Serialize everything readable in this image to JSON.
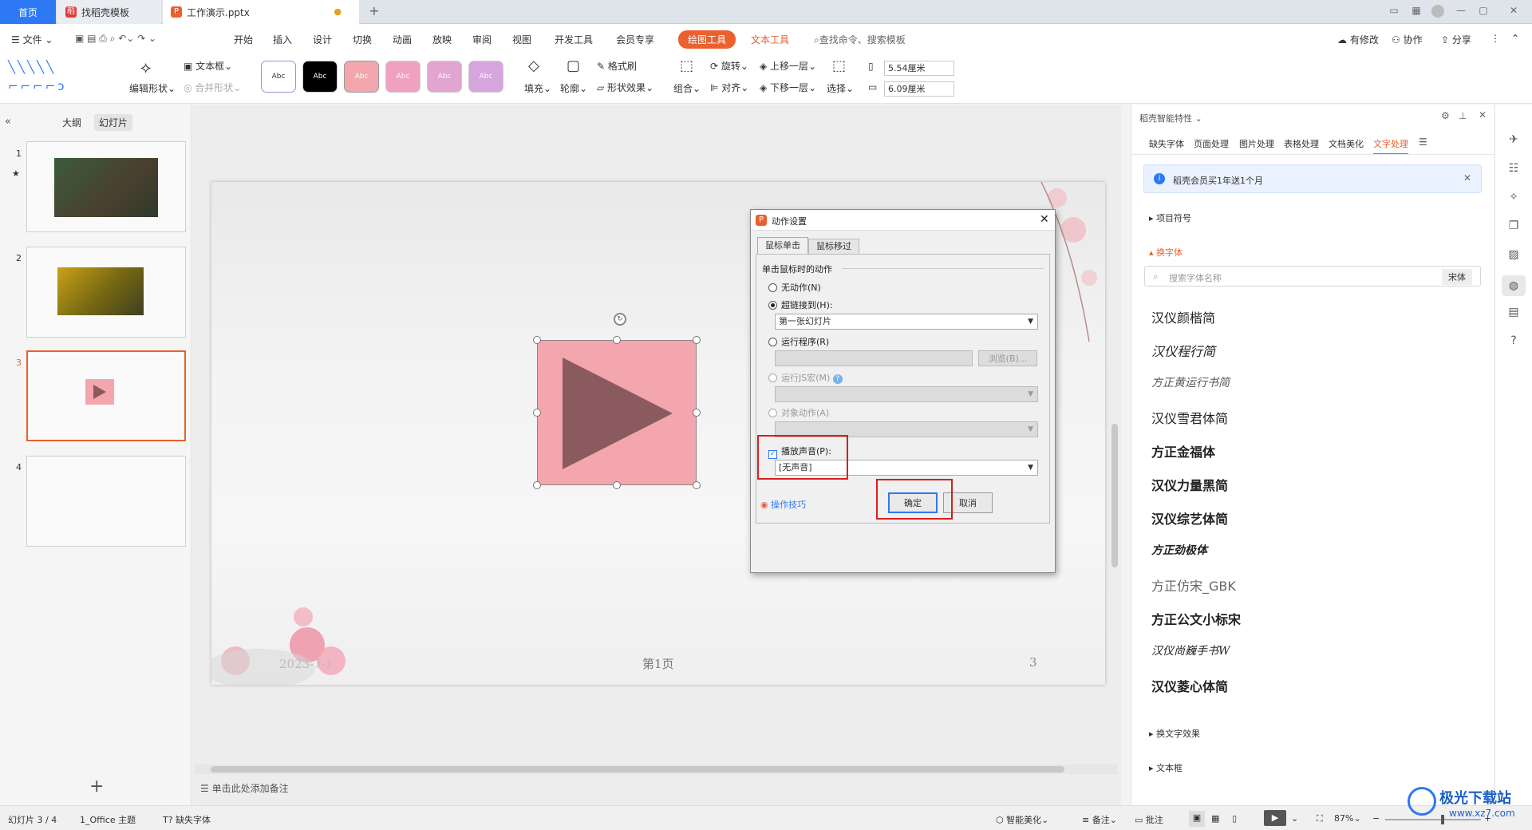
{
  "tabs": {
    "home": "首页",
    "template": "找稻壳模板",
    "file": "工作演示.pptx"
  },
  "menu": {
    "file": "文件",
    "items": [
      "开始",
      "插入",
      "设计",
      "切换",
      "动画",
      "放映",
      "审阅",
      "视图",
      "开发工具",
      "会员专享"
    ],
    "drawing_tools": "绘图工具",
    "text_tools": "文本工具",
    "search": "查找命令、搜索模板",
    "changes": "有修改",
    "collab": "协作",
    "share": "分享"
  },
  "toolbar": {
    "edit_shape": "编辑形状",
    "textbox": "文本框",
    "merge_shape": "合并形状",
    "style_label": "Abc",
    "fill": "填充",
    "outline": "轮廓",
    "format_brush": "格式刷",
    "shape_effect": "形状效果",
    "group": "组合",
    "rotate": "旋转",
    "align": "对齐",
    "bring_forward": "上移一层",
    "send_backward": "下移一层",
    "select": "选择",
    "height": "5.54厘米",
    "width": "6.09厘米"
  },
  "left_panel": {
    "outline_tab": "大纲",
    "slides_tab": "幻灯片",
    "slide_numbers": [
      "1",
      "2",
      "3",
      "4"
    ],
    "star": "★",
    "add": "+"
  },
  "slide": {
    "date": "2023-7-1",
    "footer": "第1页",
    "number": "3"
  },
  "notes_placeholder": "单击此处添加备注",
  "dialog": {
    "title": "动作设置",
    "tab_click": "鼠标单击",
    "tab_hover": "鼠标移过",
    "group_label": "单击鼠标时的动作",
    "opt_none": "无动作(N)",
    "opt_hyperlink": "超链接到(H):",
    "hyperlink_value": "第一张幻灯片",
    "opt_program": "运行程序(R)",
    "browse": "浏览(B)...",
    "opt_js": "运行JS宏(M)",
    "opt_object": "对象动作(A)",
    "play_sound": "播放声音(P):",
    "sound_value": "[无声音]",
    "tips": "操作技巧",
    "ok": "确定",
    "cancel": "取消"
  },
  "right_panel": {
    "title": "稻壳智能特性",
    "tabs": [
      "缺失字体",
      "页面处理",
      "图片处理",
      "表格处理",
      "文档美化",
      "文字处理"
    ],
    "promo": "稻壳会员买1年送1个月",
    "bullets": "项目符号",
    "change_font": "换字体",
    "search_placeholder": "搜索字体名称",
    "font_filter": "宋体",
    "fonts": [
      "汉仪颜楷简",
      "汉仪程行简",
      "方正黄运行书简",
      "汉仪雪君体简",
      "方正金福体",
      "汉仪力量黑简",
      "汉仪综艺体简",
      "方正劲极体",
      "方正仿宋_GBK",
      "方正公文小标宋",
      "汉仪尚巍手书W",
      "汉仪菱心体简"
    ],
    "text_effect": "换文字效果",
    "textbox": "文本框"
  },
  "status": {
    "slide_info": "幻灯片 3 / 4",
    "theme": "1_Office 主题",
    "missing_font": "缺失字体",
    "smart_beautify": "智能美化",
    "notes": "备注",
    "comments": "批注",
    "zoom": "87%"
  },
  "watermark": {
    "site": "极光下载站",
    "url": "www.xz7.com"
  }
}
